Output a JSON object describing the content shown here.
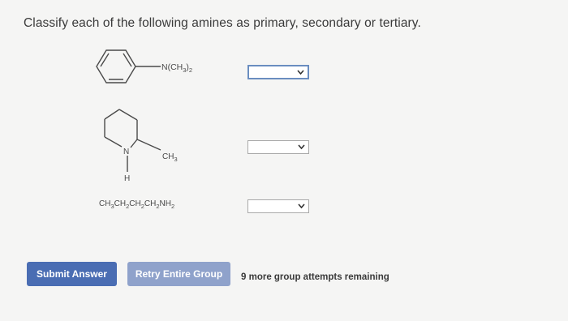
{
  "question": "Classify each of the following amines as primary, secondary or tertiary.",
  "structures": {
    "s1_substituent": "N(CH",
    "s1_sub": "3",
    "s1_close": ")",
    "s1_sub2": "2",
    "s2_n": "N",
    "s2_h": "H",
    "s2_ch": "CH",
    "s2_3": "3",
    "s3_formula_parts": [
      "CH",
      "3",
      "CH",
      "2",
      "CH",
      "2",
      "CH",
      "2",
      "NH",
      "2"
    ]
  },
  "answers": [
    {
      "selected": "",
      "focused": true
    },
    {
      "selected": "",
      "focused": false
    },
    {
      "selected": "",
      "focused": false
    }
  ],
  "buttons": {
    "submit": "Submit Answer",
    "retry": "Retry Entire Group"
  },
  "attempts_text": "9 more group attempts remaining",
  "colors": {
    "submit": "#4a6db3",
    "retry": "#8fa2cb",
    "focus_border": "#6a8dc0"
  }
}
